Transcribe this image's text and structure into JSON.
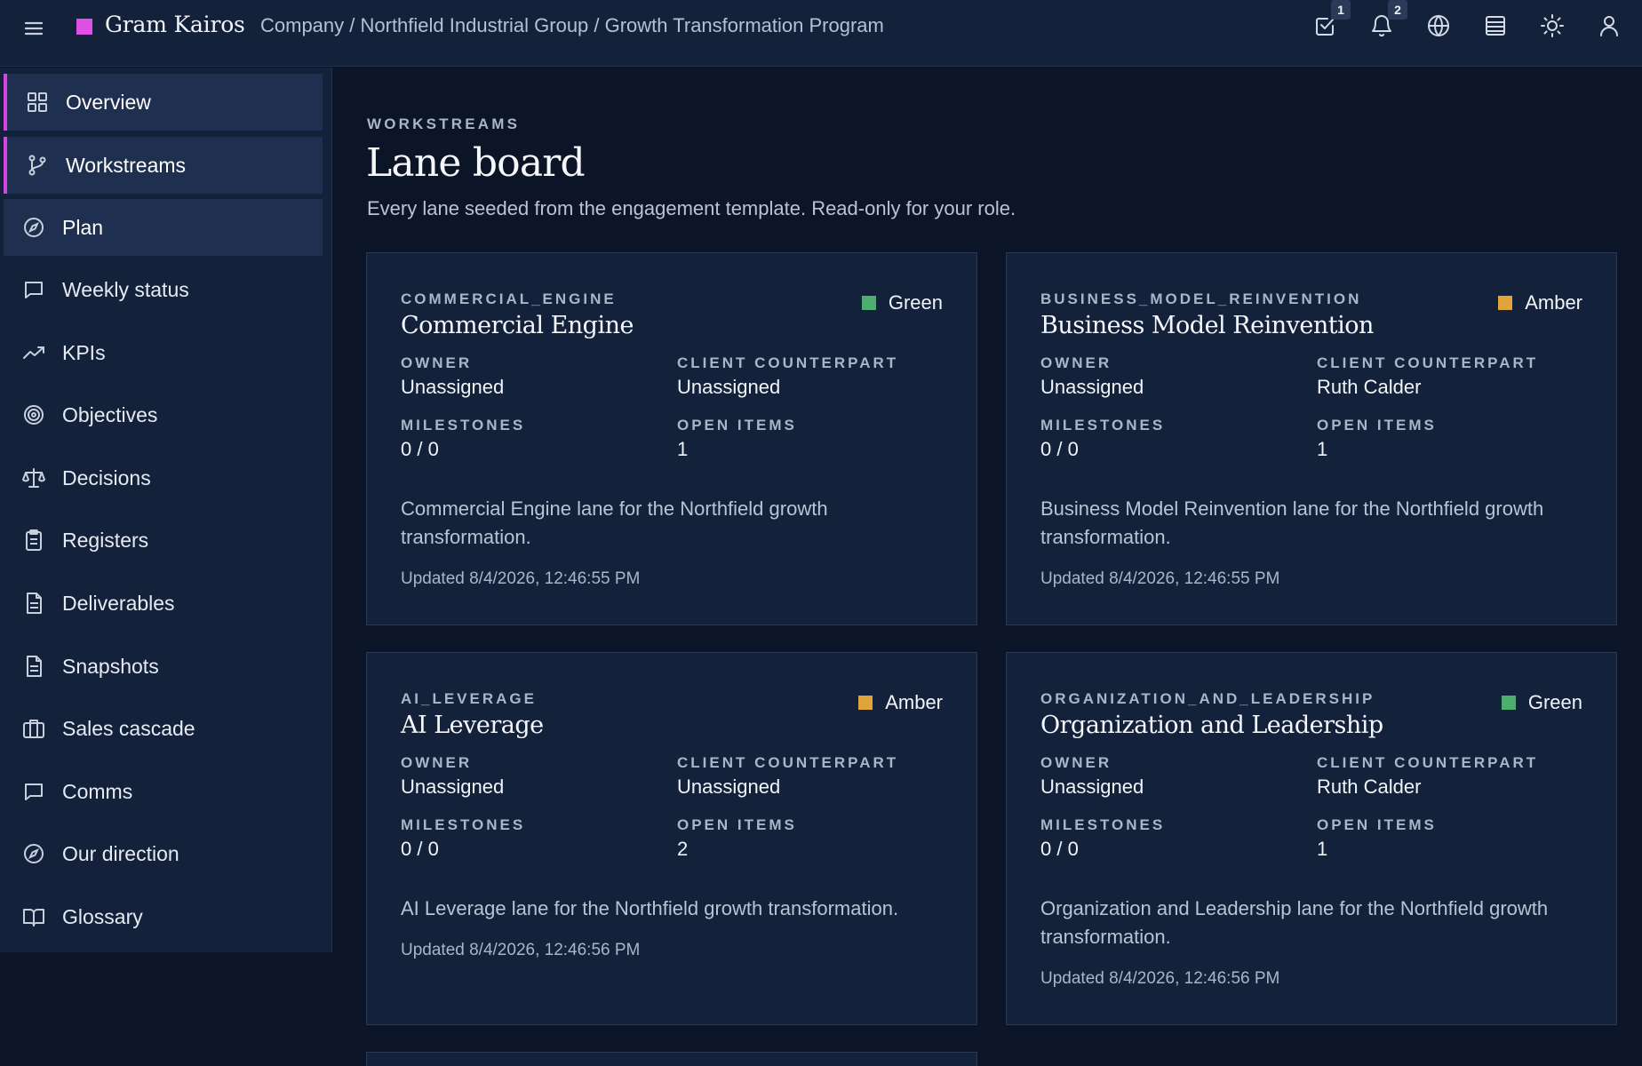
{
  "header": {
    "brand": "Gram Kairos",
    "breadcrumb": "Company / Northfield Industrial Group / Growth Transformation Program",
    "tasks_badge": "1",
    "notifications_badge": "2",
    "accent": "#e04ee3"
  },
  "sidebar": {
    "items": [
      {
        "label": "Overview",
        "icon": "grid-icon"
      },
      {
        "label": "Workstreams",
        "icon": "branch-icon"
      },
      {
        "label": "Plan",
        "icon": "compass-icon"
      },
      {
        "label": "Weekly status",
        "icon": "message-square-icon"
      },
      {
        "label": "KPIs",
        "icon": "trending-up-icon"
      },
      {
        "label": "Objectives",
        "icon": "target-icon"
      },
      {
        "label": "Decisions",
        "icon": "scale-icon"
      },
      {
        "label": "Registers",
        "icon": "clipboard-icon"
      },
      {
        "label": "Deliverables",
        "icon": "file-text-icon"
      },
      {
        "label": "Snapshots",
        "icon": "file-text-icon"
      },
      {
        "label": "Sales cascade",
        "icon": "briefcase-icon"
      },
      {
        "label": "Comms",
        "icon": "message-square-icon"
      },
      {
        "label": "Our direction",
        "icon": "compass-icon"
      },
      {
        "label": "Glossary",
        "icon": "book-open-icon"
      }
    ]
  },
  "main": {
    "eyebrow": "WORKSTREAMS",
    "title": "Lane board",
    "subtitle": "Every lane seeded from the engagement template. Read-only for your role."
  },
  "labels": {
    "owner": "OWNER",
    "counterpart": "CLIENT COUNTERPART",
    "milestones": "MILESTONES",
    "open_items": "OPEN ITEMS"
  },
  "status_colors": {
    "Green": "#4caf6e",
    "Amber": "#e0a43a"
  },
  "cards": [
    {
      "code": "COMMERCIAL_ENGINE",
      "title": "Commercial Engine",
      "status": "Green",
      "owner": "Unassigned",
      "counterpart": "Unassigned",
      "milestones": "0 / 0",
      "open_items": "1",
      "description": "Commercial Engine lane for the Northfield growth transformation.",
      "updated": "Updated 8/4/2026, 12:46:55 PM"
    },
    {
      "code": "BUSINESS_MODEL_REINVENTION",
      "title": "Business Model Reinvention",
      "status": "Amber",
      "owner": "Unassigned",
      "counterpart": "Ruth Calder",
      "milestones": "0 / 0",
      "open_items": "1",
      "description": "Business Model Reinvention lane for the Northfield growth transformation.",
      "updated": "Updated 8/4/2026, 12:46:55 PM"
    },
    {
      "code": "AI_LEVERAGE",
      "title": "AI Leverage",
      "status": "Amber",
      "owner": "Unassigned",
      "counterpart": "Unassigned",
      "milestones": "0 / 0",
      "open_items": "2",
      "description": "AI Leverage lane for the Northfield growth transformation.",
      "updated": "Updated 8/4/2026, 12:46:56 PM"
    },
    {
      "code": "ORGANIZATION_AND_LEADERSHIP",
      "title": "Organization and Leadership",
      "status": "Green",
      "owner": "Unassigned",
      "counterpart": "Ruth Calder",
      "milestones": "0 / 0",
      "open_items": "1",
      "description": "Organization and Leadership lane for the Northfield growth transformation.",
      "updated": "Updated 8/4/2026, 12:46:56 PM"
    }
  ]
}
